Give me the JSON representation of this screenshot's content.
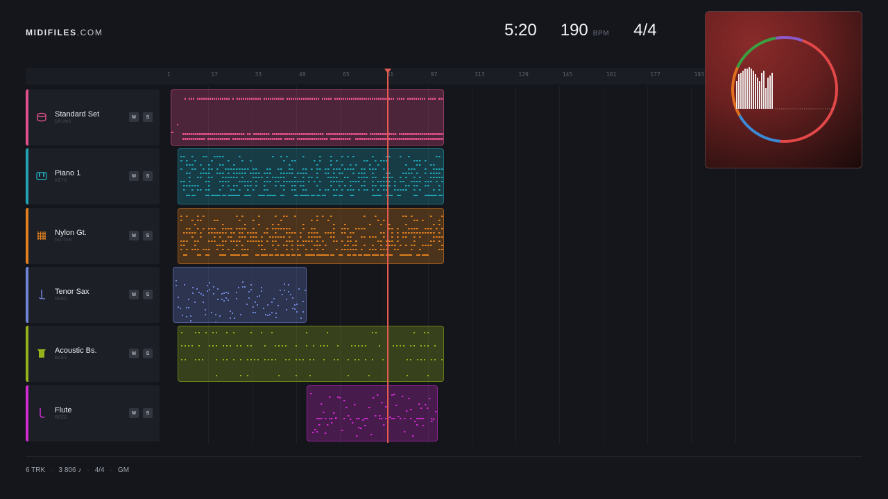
{
  "brand": {
    "name_bold": "MIDIFILES",
    "name_light": ".COM"
  },
  "transport": {
    "time": "5:20",
    "bpm": "190",
    "bpm_label": "BPM",
    "time_signature": "4/4"
  },
  "ruler": {
    "ticks": [
      "1",
      "17",
      "33",
      "49",
      "65",
      "81",
      "97",
      "113",
      "129",
      "145",
      "161",
      "177",
      "193"
    ]
  },
  "playhead": {
    "bar": "81"
  },
  "tracks": [
    {
      "name": "Standard Set",
      "category": "DRUMS",
      "color": "#e0508c",
      "icon": "drum-icon",
      "mute": "M",
      "solo": "S"
    },
    {
      "name": "Piano 1",
      "category": "KEYS",
      "color": "#21a3b5",
      "icon": "piano-icon",
      "mute": "M",
      "solo": "S"
    },
    {
      "name": "Nylon Gt.",
      "category": "GUITAR",
      "color": "#e0801f",
      "icon": "guitar-icon",
      "mute": "M",
      "solo": "S"
    },
    {
      "name": "Tenor Sax",
      "category": "REED",
      "color": "#6f86d8",
      "icon": "sax-icon",
      "mute": "M",
      "solo": "S"
    },
    {
      "name": "Acoustic Bs.",
      "category": "BASS",
      "color": "#95b41c",
      "icon": "bass-icon",
      "mute": "M",
      "solo": "S"
    },
    {
      "name": "Flute",
      "category": "REED",
      "color": "#d02cd0",
      "icon": "flute-icon",
      "mute": "M",
      "solo": "S"
    }
  ],
  "visualizer": {
    "ring_colors": [
      "#e24848",
      "#3a8ad8",
      "#e07020",
      "#3aa040",
      "#8a5ac8"
    ],
    "bar_color": "#f0eaea"
  },
  "footer": {
    "tracks": "6 TRK",
    "notes": "3 806 ♪",
    "signature": "4/4",
    "standard": "GM"
  }
}
